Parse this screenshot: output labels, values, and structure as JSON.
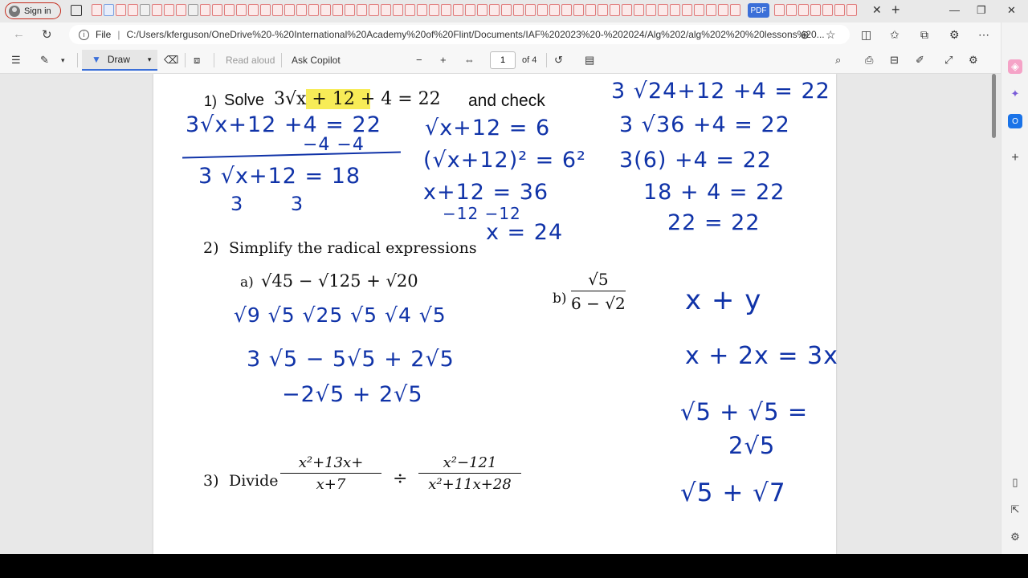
{
  "browser": {
    "signin_label": "Sign in",
    "pdf_tab_label": "PDF",
    "url_prefix": "File",
    "url": "C:/Users/kferguson/OneDrive%20-%20International%20Academy%20of%20Flint/Documents/IAF%202023%20-%202024/Alg%202/alg%202%20%20lessons%20..."
  },
  "pdf_toolbar": {
    "draw_label": "Draw",
    "read_aloud_label": "Read aloud",
    "ask_copilot_label": "Ask Copilot",
    "page_number": "1",
    "page_total": "of 4"
  },
  "document": {
    "problem1_num": "1)",
    "problem1_solve": "Solve",
    "problem1_expr": "3√x + 12 + 4  = 22",
    "problem1_tail": "and check",
    "problem2_num": "2)",
    "problem2_text": "Simplify the radical expressions",
    "problem2a_label": "a)",
    "problem2a_expr": "√45 − √125 + √20",
    "problem2b_label": "b)",
    "problem2b_num": "√5",
    "problem2b_den": "6 − √2",
    "problem3_num": "3)",
    "problem3_text": "Divide",
    "problem3_frac1_num": "x²+13x+",
    "problem3_frac1_den": "x+7",
    "problem3_op": "÷",
    "problem3_frac2_num": "x²−121",
    "problem3_frac2_den": "x²+11x+28"
  },
  "handwriting": {
    "p1_l1": "3√x+12   +4 = 22",
    "p1_l2": "−4    −4",
    "p1_l3": "3 √x+12  =  18",
    "p1_l4": "3             3",
    "p1_m1": "√x+12 = 6",
    "p1_m2": "(√x+12)² = 6²",
    "p1_m3": "x+12 = 36",
    "p1_m4": "−12   −12",
    "p1_m5": "x = 24",
    "p1_r1": "3 √24+12   +4 = 22",
    "p1_r2": "3 √36  +4 = 22",
    "p1_r3": "3(6) +4 = 22",
    "p1_r4": "18 + 4 = 22",
    "p1_r5": "22  = 22",
    "p2_l1": "√9  √5    √25 √5    √4  √5",
    "p2_l2": "3 √5 −  5√5  + 2√5",
    "p2_l3": "−2√5  + 2√5",
    "side_1": "x + y",
    "side_2": "x  + 2x = 3x",
    "side_3": "√5  + √5 =",
    "side_4": "2√5",
    "side_5": "√5  + √7"
  }
}
